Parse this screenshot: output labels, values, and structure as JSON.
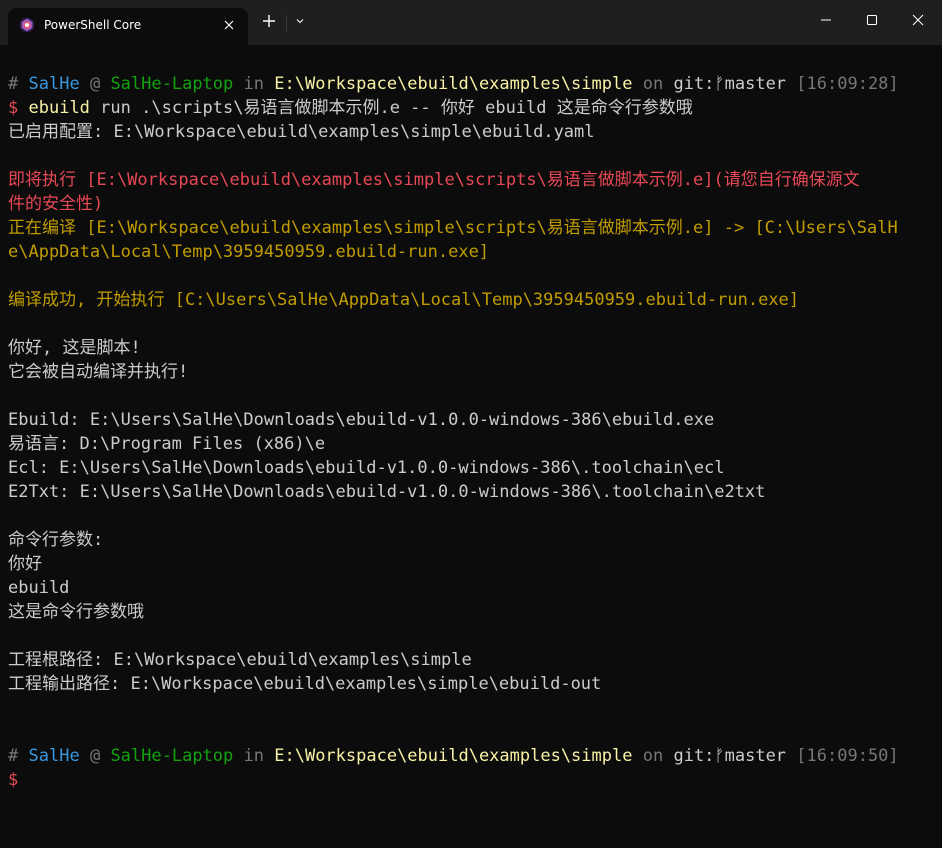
{
  "window": {
    "tab_title": "PowerShell Core",
    "tab_icon": "powershell-icon",
    "buttons": {
      "new_tab": "plus-icon",
      "dropdown": "chevron-down-icon",
      "minimize": "minimize-icon",
      "maximize": "maximize-icon",
      "close": "close-icon"
    }
  },
  "prompt1": {
    "hash": "#",
    "user": "SalHe",
    "at": "@",
    "host": "SalHe-Laptop",
    "in": "in",
    "path": "E:\\Workspace\\ebuild\\examples\\simple",
    "on": "on",
    "git": "git:",
    "branch_symbol": "ᚠ",
    "branch": "master",
    "time": "[16:09:28]"
  },
  "command": {
    "dollar": "$",
    "cmd": "ebuild",
    "args": "run .\\scripts\\易语言做脚本示例.e -- 你好 ebuild 这是命令行参数哦"
  },
  "output": [
    {
      "color": "white",
      "text": "已启用配置: E:\\Workspace\\ebuild\\examples\\simple\\ebuild.yaml"
    },
    {
      "color": "white",
      "text": ""
    },
    {
      "color": "red",
      "text": "即将执行 [E:\\Workspace\\ebuild\\examples\\simple\\scripts\\易语言做脚本示例.e](请您自行确保源文"
    },
    {
      "color": "red",
      "text": "件的安全性)"
    },
    {
      "color": "orange",
      "text": "正在编译 [E:\\Workspace\\ebuild\\examples\\simple\\scripts\\易语言做脚本示例.e] -> [C:\\Users\\SalH"
    },
    {
      "color": "orange",
      "text": "e\\AppData\\Local\\Temp\\3959450959.ebuild-run.exe]"
    },
    {
      "color": "white",
      "text": ""
    },
    {
      "color": "orange",
      "text": "编译成功, 开始执行 [C:\\Users\\SalHe\\AppData\\Local\\Temp\\3959450959.ebuild-run.exe]"
    },
    {
      "color": "white",
      "text": ""
    },
    {
      "color": "white",
      "text": "你好, 这是脚本!"
    },
    {
      "color": "white",
      "text": "它会被自动编译并执行!"
    },
    {
      "color": "white",
      "text": ""
    },
    {
      "color": "white",
      "text": "Ebuild: E:\\Users\\SalHe\\Downloads\\ebuild-v1.0.0-windows-386\\ebuild.exe"
    },
    {
      "color": "white",
      "text": "易语言: D:\\Program Files (x86)\\e"
    },
    {
      "color": "white",
      "text": "Ecl: E:\\Users\\SalHe\\Downloads\\ebuild-v1.0.0-windows-386\\.toolchain\\ecl"
    },
    {
      "color": "white",
      "text": "E2Txt: E:\\Users\\SalHe\\Downloads\\ebuild-v1.0.0-windows-386\\.toolchain\\e2txt"
    },
    {
      "color": "white",
      "text": ""
    },
    {
      "color": "white",
      "text": "命令行参数:"
    },
    {
      "color": "white",
      "text": "你好"
    },
    {
      "color": "white",
      "text": "ebuild"
    },
    {
      "color": "white",
      "text": "这是命令行参数哦"
    },
    {
      "color": "white",
      "text": ""
    },
    {
      "color": "white",
      "text": "工程根路径: E:\\Workspace\\ebuild\\examples\\simple"
    },
    {
      "color": "white",
      "text": "工程输出路径: E:\\Workspace\\ebuild\\examples\\simple\\ebuild-out"
    },
    {
      "color": "white",
      "text": ""
    },
    {
      "color": "white",
      "text": ""
    }
  ],
  "prompt2": {
    "hash": "#",
    "user": "SalHe",
    "at": "@",
    "host": "SalHe-Laptop",
    "in": "in",
    "path": "E:\\Workspace\\ebuild\\examples\\simple",
    "on": "on",
    "git": "git:",
    "branch_symbol": "ᚠ",
    "branch": "master",
    "time": "[16:09:50]"
  },
  "final_prompt": {
    "dollar": "$"
  },
  "colors": {
    "background": "#0c0c0c",
    "titlebar": "#1f1f1f",
    "blue": "#3a96dd",
    "green": "#13a10e",
    "yellow": "#f9f1a5",
    "red": "#e74856",
    "orange": "#c19c00"
  }
}
